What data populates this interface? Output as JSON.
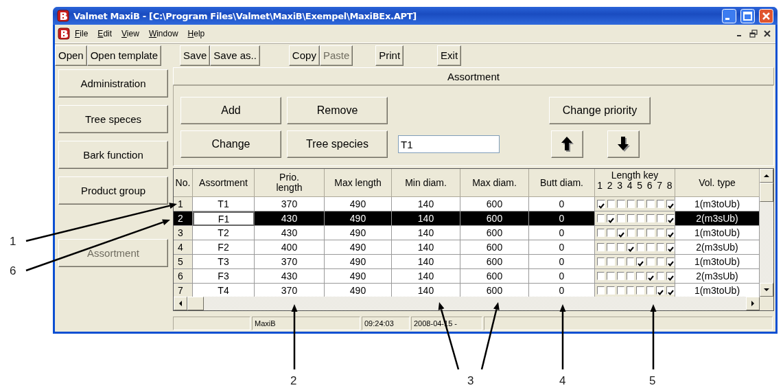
{
  "window": {
    "title": "Valmet MaxiB - [C:\\Program Files\\Valmet\\MaxiB\\Exempel\\MaxiBEx.APT]"
  },
  "menu": [
    {
      "label": "File"
    },
    {
      "label": "Edit"
    },
    {
      "label": "View"
    },
    {
      "label": "Window"
    },
    {
      "label": "Help"
    }
  ],
  "toolbar": [
    [
      {
        "label": "Open",
        "disabled": false
      },
      {
        "label": "Open template",
        "disabled": false
      }
    ],
    [
      {
        "label": "Save",
        "disabled": false
      },
      {
        "label": "Save as..",
        "disabled": false
      }
    ],
    [
      {
        "label": "Copy",
        "disabled": false
      },
      {
        "label": "Paste",
        "disabled": true
      }
    ],
    [
      {
        "label": "Print",
        "disabled": false
      }
    ],
    [
      {
        "label": "Exit",
        "disabled": false
      }
    ]
  ],
  "sidebar": [
    {
      "label": "Administration",
      "disabled": false
    },
    {
      "label": "Tree speces",
      "disabled": false
    },
    {
      "label": "Bark function",
      "disabled": false
    },
    {
      "label": "Product group",
      "disabled": false
    },
    {
      "label": "Assortment",
      "disabled": true
    }
  ],
  "panel": {
    "title": "Assortment",
    "add": "Add",
    "remove": "Remove",
    "change_priority": "Change priority",
    "change": "Change",
    "tree_species": "Tree species",
    "tree_species_field": {
      "value": "T1"
    }
  },
  "table": {
    "columns": [
      {
        "label": "No."
      },
      {
        "label": "Assortment"
      },
      {
        "label": "Prio. length"
      },
      {
        "label": "Max length"
      },
      {
        "label": "Min diam."
      },
      {
        "label": "Max diam."
      },
      {
        "label": "Butt diam."
      },
      {
        "label": "Length key",
        "sub": [
          "1",
          "2",
          "3",
          "4",
          "5",
          "6",
          "7",
          "8"
        ]
      },
      {
        "label": "Vol. type"
      }
    ],
    "rows": [
      {
        "no": "1",
        "assortment": "T1",
        "prio_length": "370",
        "max_length": "490",
        "min_diam": "140",
        "max_diam": "600",
        "butt_diam": "0",
        "length_key": [
          true,
          false,
          false,
          false,
          false,
          false,
          false,
          true
        ],
        "vol_type": "1(m3toUb)",
        "selected": false
      },
      {
        "no": "2",
        "assortment": "F1",
        "prio_length": "430",
        "max_length": "490",
        "min_diam": "140",
        "max_diam": "600",
        "butt_diam": "0",
        "length_key": [
          false,
          true,
          false,
          false,
          false,
          false,
          false,
          true
        ],
        "vol_type": "2(m3sUb)",
        "selected": true
      },
      {
        "no": "3",
        "assortment": "T2",
        "prio_length": "430",
        "max_length": "490",
        "min_diam": "140",
        "max_diam": "600",
        "butt_diam": "0",
        "length_key": [
          false,
          false,
          true,
          false,
          false,
          false,
          false,
          true
        ],
        "vol_type": "1(m3toUb)",
        "selected": false
      },
      {
        "no": "4",
        "assortment": "F2",
        "prio_length": "400",
        "max_length": "490",
        "min_diam": "140",
        "max_diam": "600",
        "butt_diam": "0",
        "length_key": [
          false,
          false,
          false,
          true,
          false,
          false,
          false,
          true
        ],
        "vol_type": "2(m3sUb)",
        "selected": false
      },
      {
        "no": "5",
        "assortment": "T3",
        "prio_length": "370",
        "max_length": "490",
        "min_diam": "140",
        "max_diam": "600",
        "butt_diam": "0",
        "length_key": [
          false,
          false,
          false,
          false,
          true,
          false,
          false,
          true
        ],
        "vol_type": "1(m3toUb)",
        "selected": false
      },
      {
        "no": "6",
        "assortment": "F3",
        "prio_length": "430",
        "max_length": "490",
        "min_diam": "140",
        "max_diam": "600",
        "butt_diam": "0",
        "length_key": [
          false,
          false,
          false,
          false,
          false,
          true,
          false,
          true
        ],
        "vol_type": "2(m3sUb)",
        "selected": false
      },
      {
        "no": "7",
        "assortment": "T4",
        "prio_length": "370",
        "max_length": "490",
        "min_diam": "140",
        "max_diam": "600",
        "butt_diam": "0",
        "length_key": [
          false,
          false,
          false,
          false,
          false,
          false,
          true,
          true
        ],
        "vol_type": "1(m3toUb)",
        "selected": false
      }
    ]
  },
  "status_bar": [
    "MaxiB",
    "09:24:03",
    "2008-04-15 -"
  ],
  "callouts": [
    {
      "label": "1"
    },
    {
      "label": "6"
    },
    {
      "label": "2"
    },
    {
      "label": "3"
    },
    {
      "label": "4"
    },
    {
      "label": "5"
    }
  ]
}
